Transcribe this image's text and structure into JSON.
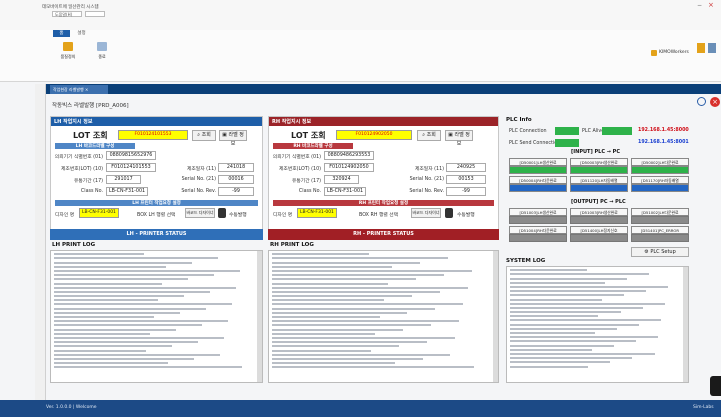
{
  "window": {
    "title": "데모바이트에 일산관리 시스템",
    "sub": "도움말(H)",
    "close": "×",
    "min": "−",
    "max": "□"
  },
  "ribbon": {
    "tab_home": "홈",
    "tab_settings": "설정",
    "btn1": "품질정의",
    "btn2": "종료",
    "user": "KIMOWorkers",
    "gear": "⚙"
  },
  "tab": {
    "label": "작업현장 라벨발행 ×"
  },
  "page": {
    "title": "작동빅스 라벨발행 [PRD_A006]"
  },
  "lh": {
    "header": "LH 작업지시 정보",
    "lot_label": "LOT 조회",
    "lot_value": "F010124101553",
    "search_label": "조회",
    "print_label": "라벨 정보",
    "sub_header": "LH 바코드라벨 구성",
    "fields": [
      {
        "k": "의뢰기기 식별번호 (01)",
        "v": "08809815652976"
      },
      {
        "k": "제조번호(LOT) (10)",
        "v": "F010124101553"
      },
      {
        "k": "유통기간 (17)",
        "v": "291017"
      },
      {
        "k": "Class No.",
        "v": "LB-CN-F31-001"
      }
    ],
    "right_fields": [
      {
        "k": "제조일자 (11)",
        "v": "241018"
      },
      {
        "k": "Serial No. (21)",
        "v": "00016"
      },
      {
        "k": "Serial No. Rev.",
        "v": "-99"
      }
    ],
    "print_sub": "LH 프린터 작업요청 설정",
    "design_label": "디자인 명",
    "design_value": "LB-CN-F31-001",
    "box_label": "BOX LH 행렬 선택",
    "btn_a": "바코드 다자이너",
    "btn_b": "수동발행",
    "status": "LH - PRINTER STATUS",
    "log_title": "LH PRINT LOG"
  },
  "rh": {
    "header": "RH 작업지시 정보",
    "lot_label": "LOT 조회",
    "lot_value": "F010124902050",
    "search_label": "조회",
    "print_label": "라벨 정보",
    "sub_header": "RH 바코드라벨 구성",
    "fields": [
      {
        "k": "의뢰기기 식별번호 (01)",
        "v": "08809486293553"
      },
      {
        "k": "제조번호(LOT) (10)",
        "v": "F010124902050"
      },
      {
        "k": "유통기간 (17)",
        "v": "320924"
      },
      {
        "k": "Class No.",
        "v": "LB-CN-F31-001"
      }
    ],
    "right_fields": [
      {
        "k": "제조일자 (11)",
        "v": "240925"
      },
      {
        "k": "Serial No. (21)",
        "v": "00153"
      },
      {
        "k": "Serial No. Rev.",
        "v": "-99"
      }
    ],
    "print_sub": "RH 프린터 작업요청 설정",
    "design_label": "디자인 명",
    "design_value": "LB-CN-F31-001",
    "box_label": "BOX RH 행렬 선택",
    "btn_a": "바코드 다자이너",
    "btn_b": "수동발행",
    "status": "RH - PRINTER STATUS",
    "log_title": "RH PRINT LOG"
  },
  "plc": {
    "title": "PLC Info",
    "conn1": "PLC Connection",
    "conn1_ip": "192.168.1.45:8000",
    "conn1_state": "PLC Alive",
    "conn2": "PLC Send Connection",
    "conn2_ip": "192.168.1.45:8001",
    "input_title": "[INPUT] PLC → PC",
    "inputs": [
      "[D50001]LH생산완료",
      "[D50003]RH생산완료",
      "[D50002]LH다운완료",
      "[D50004]RH다운완료",
      "[D51120]LH자동배열",
      "[D51170]RH자동배열"
    ],
    "output_title": "[OUTPUT] PC → PLC",
    "outputs": [
      "[D51003]LH생산완료",
      "[D51003]RH생산완료",
      "[D51002]LH다운완료",
      "[D51004]RH다운완료",
      "[D51400]LH정지신호",
      "[D51401]PC_ERROR"
    ],
    "setup": "PLC Setup"
  },
  "syslog": {
    "title": "SYSTEM LOG"
  },
  "status": {
    "version": "Ver. 1.0.0.0 | Welcome",
    "right": "Sim-Labs"
  },
  "colors": {
    "blue_header": "#1e5ea8",
    "red_header": "#9b2328",
    "yellow": "#ffff00",
    "green": "#2eb24a"
  }
}
